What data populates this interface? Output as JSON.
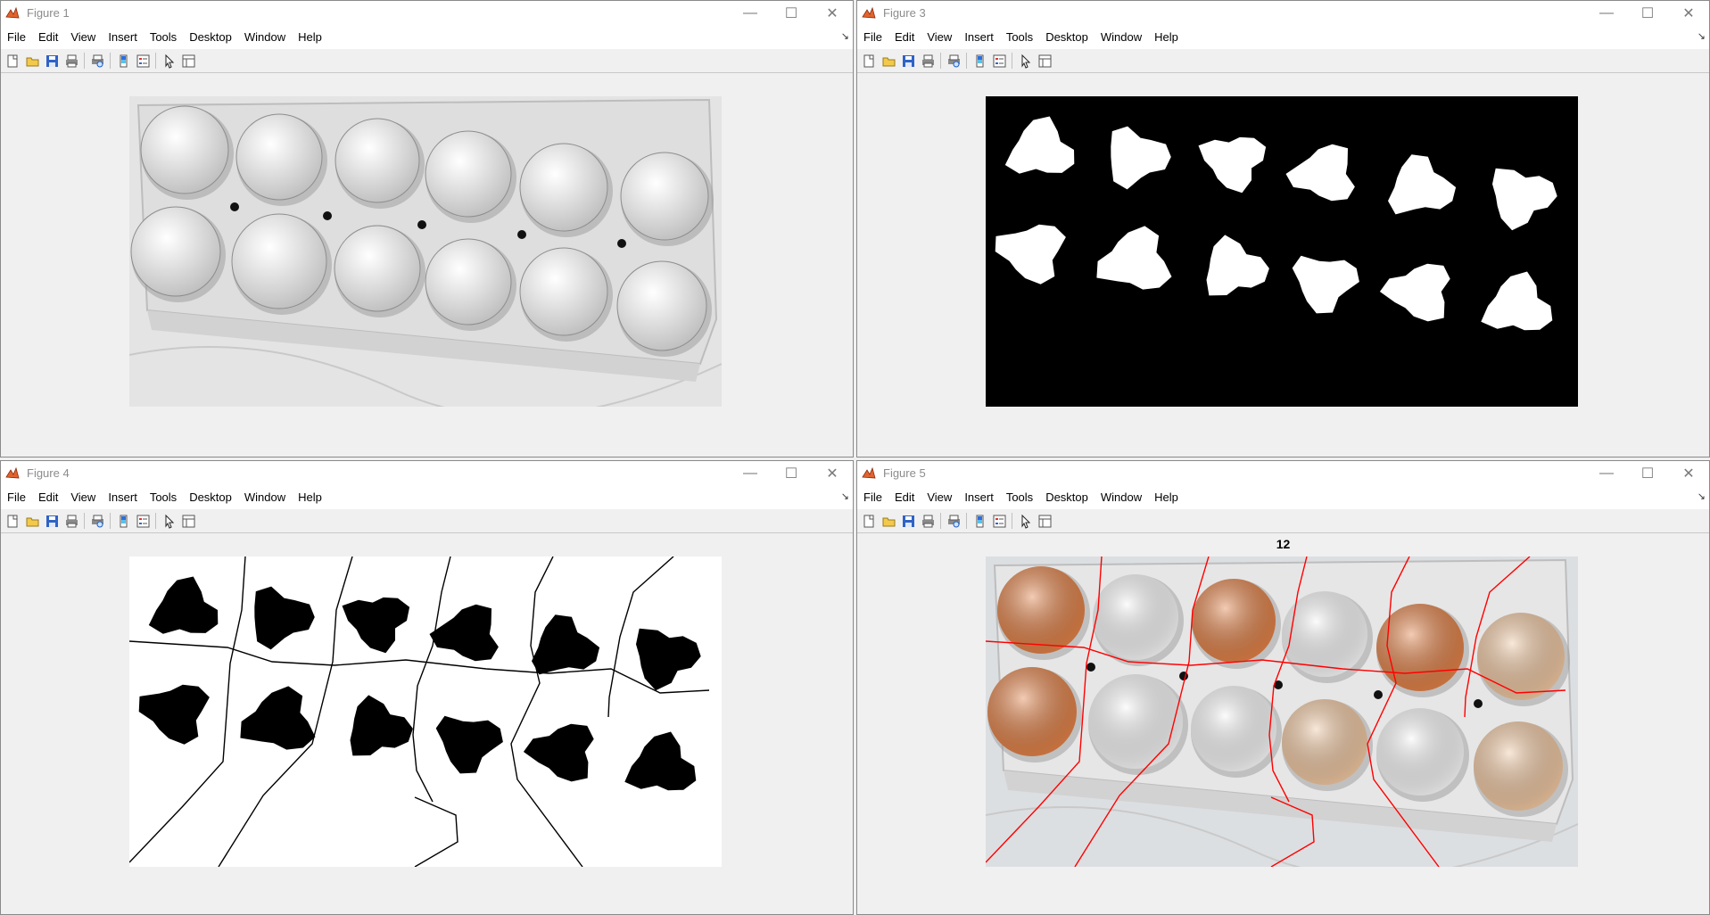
{
  "menu": [
    "File",
    "Edit",
    "View",
    "Insert",
    "Tools",
    "Desktop",
    "Window",
    "Help"
  ],
  "windows": [
    {
      "title": "Figure 1"
    },
    {
      "title": "Figure 3"
    },
    {
      "title": "Figure 4"
    },
    {
      "title": "Figure 5",
      "axes_title": "12"
    }
  ],
  "icons": {
    "app": "matlab-icon",
    "minimize": "minimize-icon",
    "maximize": "maximize-icon",
    "close": "close-icon",
    "dock": "dock-arrow-icon",
    "toolbar": [
      "new-figure-icon",
      "open-icon",
      "save-icon",
      "print-icon",
      "print-preview-icon",
      "colorbar-icon",
      "legend-icon",
      "edit-plot-icon",
      "property-editor-icon"
    ]
  },
  "colors": {
    "egg_brown": "#e07f45",
    "egg_tan": "#efc6a0",
    "egg_white": "#f7f7f7",
    "carton": "#e6e6e6",
    "watershed_line": "#ff0000",
    "mask_fg": "#ffffff",
    "mask_bg": "#000000"
  },
  "eggs": {
    "top_row_colors": [
      "brown",
      "white",
      "brown",
      "white",
      "brown",
      "tan"
    ],
    "bottom_row_colors": [
      "brown",
      "white",
      "white",
      "tan",
      "white",
      "tan"
    ]
  }
}
